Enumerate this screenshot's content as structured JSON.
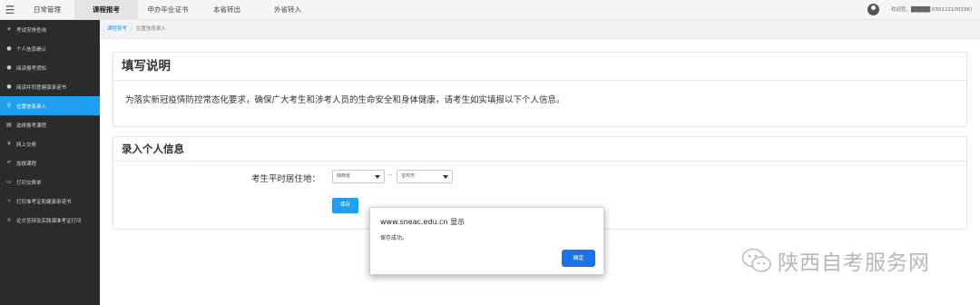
{
  "nav": {
    "menu_icon": "hamburger-icon",
    "tabs": [
      {
        "label": "日常管理"
      },
      {
        "label": "课程报考"
      },
      {
        "label": "申办毕业证书"
      },
      {
        "label": "本省转出"
      },
      {
        "label": "外省转入"
      }
    ],
    "active_tab": "课程报考",
    "user_icon": "user-avatar-icon",
    "welcome_text": "欢迎您，█████ 030122100336）"
  },
  "sidebar": {
    "items": [
      {
        "icon": "plane-icon",
        "label": "考试安排查询"
      },
      {
        "icon": "speech-bubble-icon",
        "label": "个人信息确认"
      },
      {
        "icon": "speech-bubble-icon",
        "label": "阅读报考须知"
      },
      {
        "icon": "speech-bubble-icon",
        "label": "阅读并同意健康承诺书"
      },
      {
        "icon": "map-marker-icon",
        "label": "位置信息录入"
      },
      {
        "icon": "document-icon",
        "label": "选择报考课程"
      },
      {
        "icon": "yen-icon",
        "label": "网上交费"
      },
      {
        "icon": "undo-icon",
        "label": "加报课程"
      },
      {
        "icon": "ticket-icon",
        "label": "打印交费单"
      },
      {
        "icon": "fork-icon",
        "label": "打印准考证和健康承诺书"
      },
      {
        "icon": "trophy-icon",
        "label": "论文答辩及实践课准考证打印"
      }
    ],
    "active_label": "位置信息录入"
  },
  "breadcrumb": {
    "parent": "课程报考",
    "separator": "/",
    "current": "位置信息录入"
  },
  "notice": {
    "title": "填写说明",
    "text": "为落实新冠疫情防控常态化要求，确保广大考生和涉考人员的生命安全和身体健康，请考生如实填报以下个人信息。"
  },
  "form": {
    "title": "录入个人信息",
    "residence_label": "考生平时居住地：",
    "province_value": "陕西省",
    "separator": "--",
    "city_value": "宝鸡市",
    "save_label": "保存"
  },
  "dialog": {
    "origin": "www.sneac.edu.cn 显示",
    "message": "保存成功。",
    "ok_label": "确定"
  },
  "watermark": {
    "icon": "wechat-icon",
    "text": "陕西自考服务网"
  },
  "colors": {
    "accent_blue": "#1e9ff2",
    "dialog_button": "#1a73e8",
    "sidebar_bg": "#2b2b2b"
  }
}
